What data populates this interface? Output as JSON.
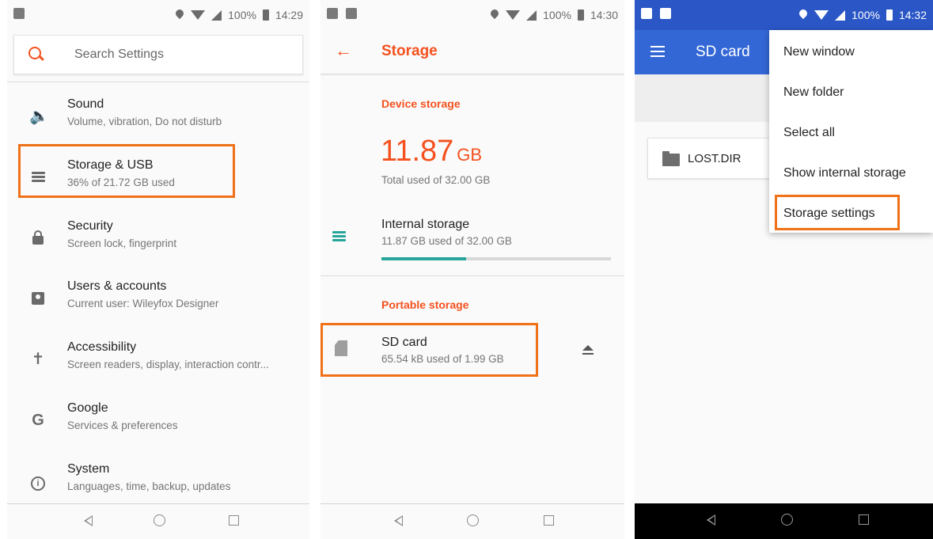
{
  "panel1": {
    "status": {
      "battery": "100%",
      "time": "14:29"
    },
    "search": {
      "placeholder": "Search Settings"
    },
    "items": [
      {
        "title": "Sound",
        "subtitle": "Volume, vibration, Do not disturb",
        "icon": "volume-icon"
      },
      {
        "title": "Storage & USB",
        "subtitle": "36% of 21.72 GB used",
        "icon": "storage-icon"
      },
      {
        "title": "Security",
        "subtitle": "Screen lock, fingerprint",
        "icon": "lock-icon"
      },
      {
        "title": "Users & accounts",
        "subtitle": "Current user: Wileyfox Designer",
        "icon": "account-icon"
      },
      {
        "title": "Accessibility",
        "subtitle": "Screen readers, display, interaction contr...",
        "icon": "accessibility-icon"
      },
      {
        "title": "Google",
        "subtitle": "Services & preferences",
        "icon": "google-icon"
      },
      {
        "title": "System",
        "subtitle": "Languages, time, backup, updates",
        "icon": "info-icon"
      }
    ]
  },
  "panel2": {
    "status": {
      "battery": "100%",
      "time": "14:30"
    },
    "title": "Storage",
    "device_storage_label": "Device storage",
    "used_value": "11.87",
    "used_unit": "GB",
    "total_used": "Total used of 32.00 GB",
    "internal": {
      "title": "Internal storage",
      "subtitle": "11.87 GB used of 32.00 GB",
      "progress": 0.37
    },
    "portable_storage_label": "Portable storage",
    "sdcard": {
      "title": "SD card",
      "subtitle": "65.54 kB used of 1.99 GB"
    }
  },
  "panel3": {
    "status": {
      "battery": "100%",
      "time": "14:32"
    },
    "title": "SD card",
    "folder": "LOST.DIR",
    "menu": [
      "New window",
      "New folder",
      "Select all",
      "Show internal storage",
      "Storage settings"
    ]
  },
  "colors": {
    "accent": "#f4511e",
    "highlight": "#f07118",
    "teal": "#26a69a",
    "blue_bar": "#3367d6"
  }
}
